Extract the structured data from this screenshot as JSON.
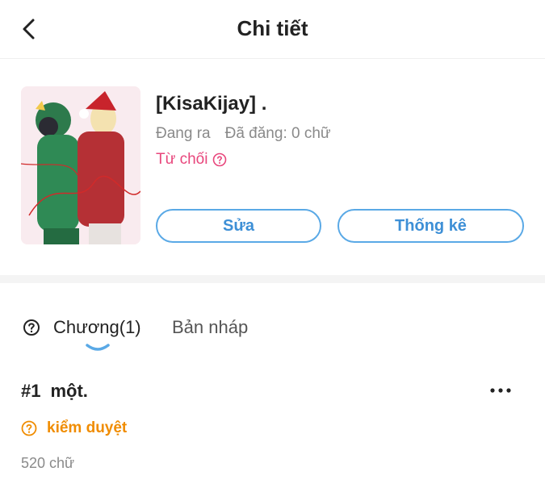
{
  "header": {
    "title": "Chi tiết"
  },
  "book": {
    "title": "[KisaKijay] .",
    "status": "Đang ra",
    "published": "Đã đăng: 0 chữ",
    "review_state": "Từ chối",
    "edit_label": "Sửa",
    "stats_label": "Thống kê"
  },
  "tabs": [
    {
      "label": "Chương(1)",
      "active": true
    },
    {
      "label": "Bản nháp",
      "active": false
    }
  ],
  "chapters": [
    {
      "number": "#1",
      "title": "một.",
      "status": "kiểm duyệt",
      "words": "520 chữ"
    }
  ],
  "colors": {
    "accent": "#3d8fd6",
    "rejected": "#e8467c",
    "pending": "#f08c00",
    "muted": "#8a8a8a"
  },
  "icons": [
    "back-arrow-icon",
    "question-circle-icon",
    "more-dots-icon"
  ]
}
